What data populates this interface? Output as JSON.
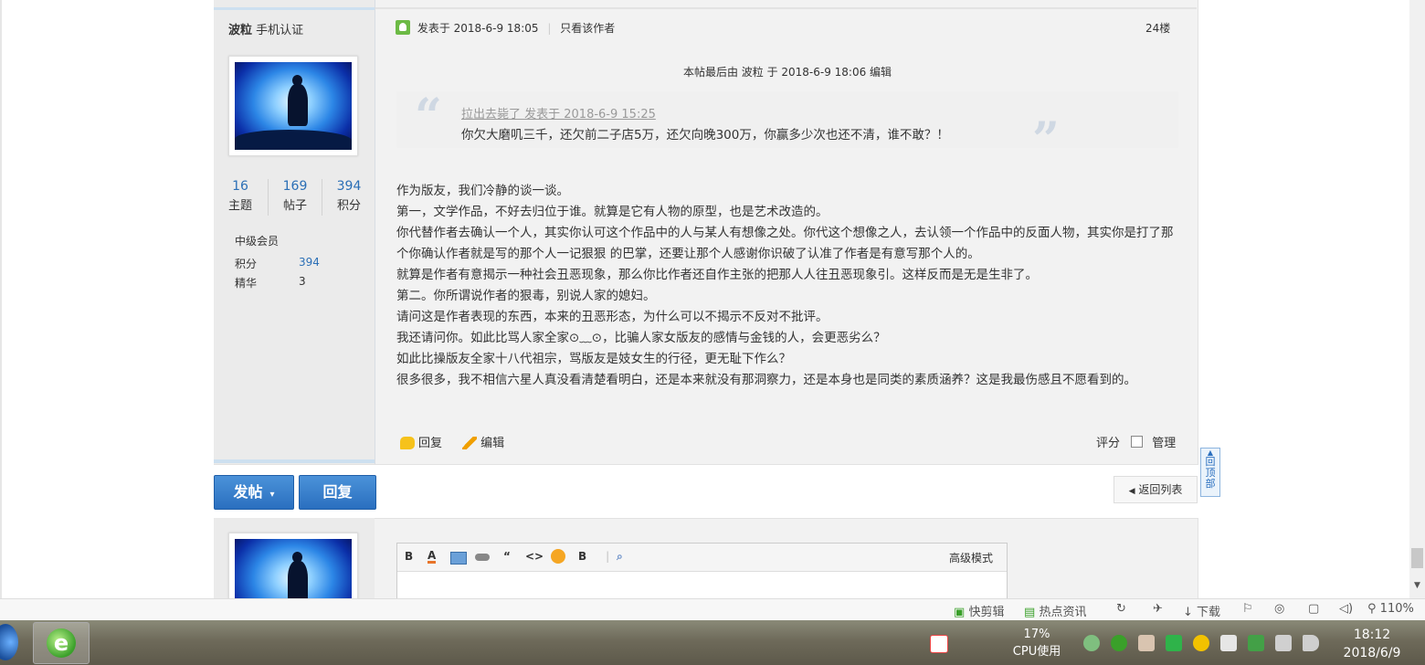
{
  "post": {
    "author": "波粒",
    "author_badge": "手机认证",
    "stats": [
      {
        "value": "16",
        "label": "主题"
      },
      {
        "value": "169",
        "label": "帖子"
      },
      {
        "value": "394",
        "label": "积分"
      }
    ],
    "level": "中级会员",
    "points_label": "积分",
    "points_value": "394",
    "essence_label": "精华",
    "essence_value": "3",
    "meta_posted": "发表于 2018-6-9 18:05",
    "meta_only_author": "只看该作者",
    "floor": "24楼",
    "edit_note": "本帖最后由 波粒 于 2018-6-9 18:06 编辑",
    "quote": {
      "source": "拉出去毙了 发表于 2018-6-9 15:25",
      "text": "你欠大磨叽三千，还欠前二子店5万，还欠向晚300万，你赢多少次也还不清，谁不敢？！"
    },
    "body": [
      "作为版友，我们冷静的谈一谈。",
      "第一，文学作品，不好去归位于谁。就算是它有人物的原型，也是艺术改造的。",
      "你代替作者去确认一个人，其实你认可这个作品中的人与某人有想像之处。你代这个想像之人，去认领一个作品中的反面人物，其实你是打了那个你确认作者就是写的那个人一记狠狠 的巴掌，还要让那个人感谢你识破了认准了作者是有意写那个人的。",
      "就算是作者有意揭示一种社会丑恶现象，那么你比作者还自作主张的把那人人往丑恶现象引。这样反而是无是生非了。",
      "第二。你所谓说作者的狠毒，别说人家的媳妇。",
      "请问这是作者表现的东西，本来的丑恶形态，为什么可以不揭示不反对不批评。",
      "我还请问你。如此比骂人家全家⊙﹏⊙，比骗人家女版友的感情与金钱的人，会更恶劣么？",
      "如此比操版友全家十八代祖宗，骂版友是妓女生的行径，更无耻下作么？",
      "很多很多，我不相信六星人真没看清楚看明白，还是本来就没有那洞察力，还是本身也是同类的素质涵养？这是我最伤感且不愿看到的。"
    ],
    "actions": {
      "reply": "回复",
      "edit": "编辑",
      "rate": "评分",
      "manage": "管理"
    }
  },
  "buttons": {
    "new_post": "发帖",
    "reply": "回复",
    "back_list": "返回列表",
    "go_top": "回顶部"
  },
  "editor": {
    "advanced_mode": "高级模式",
    "toolbar": [
      "B",
      "A",
      "img",
      "link",
      "“",
      "<>",
      "emoji",
      "B",
      "attach"
    ]
  },
  "statusbar": [
    "快剪辑",
    "热点资讯",
    "下载",
    "110%"
  ],
  "taskbar": {
    "cpu_percent": "17%",
    "cpu_label": "CPU使用",
    "time": "18:12",
    "date": "2018/6/9"
  }
}
